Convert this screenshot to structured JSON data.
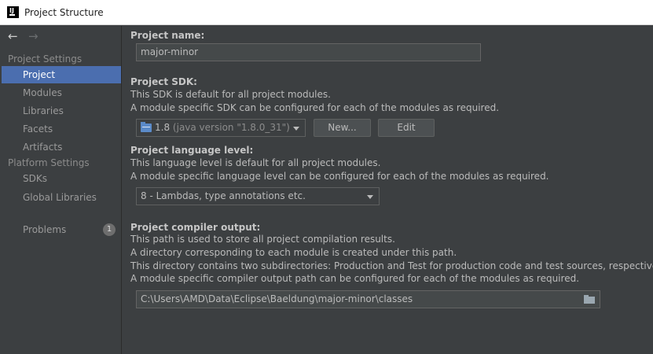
{
  "window": {
    "title": "Project Structure",
    "app_icon": "intellij-idea-icon"
  },
  "nav": {
    "back_icon": "arrow-left-icon",
    "forward_icon": "arrow-right-icon"
  },
  "sidebar": {
    "project_settings_header": "Project Settings",
    "platform_settings_header": "Platform Settings",
    "items": [
      {
        "label": "Project",
        "active": true
      },
      {
        "label": "Modules"
      },
      {
        "label": "Libraries"
      },
      {
        "label": "Facets"
      },
      {
        "label": "Artifacts"
      },
      {
        "label": "SDKs"
      },
      {
        "label": "Global Libraries"
      },
      {
        "label": "Problems",
        "badge": "1"
      }
    ]
  },
  "main": {
    "project_name": {
      "label": "Project name:",
      "value": "major-minor"
    },
    "sdk": {
      "label": "Project SDK:",
      "desc1": "This SDK is default for all project modules.",
      "desc2": "A module specific SDK can be configured for each of the modules as required.",
      "selected_version": "1.8",
      "selected_detail": "(java version \"1.8.0_31\")",
      "new_button": "New...",
      "edit_button": "Edit"
    },
    "language_level": {
      "label": "Project language level:",
      "desc1": "This language level is default for all project modules.",
      "desc2": "A module specific language level can be configured for each of the modules as required.",
      "selected": "8 - Lambdas, type annotations etc."
    },
    "compiler_output": {
      "label": "Project compiler output:",
      "desc1": "This path is used to store all project compilation results.",
      "desc2": "A directory corresponding to each module is created under this path.",
      "desc3": "This directory contains two subdirectories: Production and Test for production code and test sources, respectively.",
      "desc4": "A module specific compiler output path can be configured for each of the modules as required.",
      "path": "C:\\Users\\AMD\\Data\\Eclipse\\Baeldung\\major-minor\\classes"
    }
  },
  "colors": {
    "background": "#3c3f41",
    "selection": "#4b6eaf",
    "text": "#bbbbbb",
    "titlebar": "#ffffff"
  }
}
